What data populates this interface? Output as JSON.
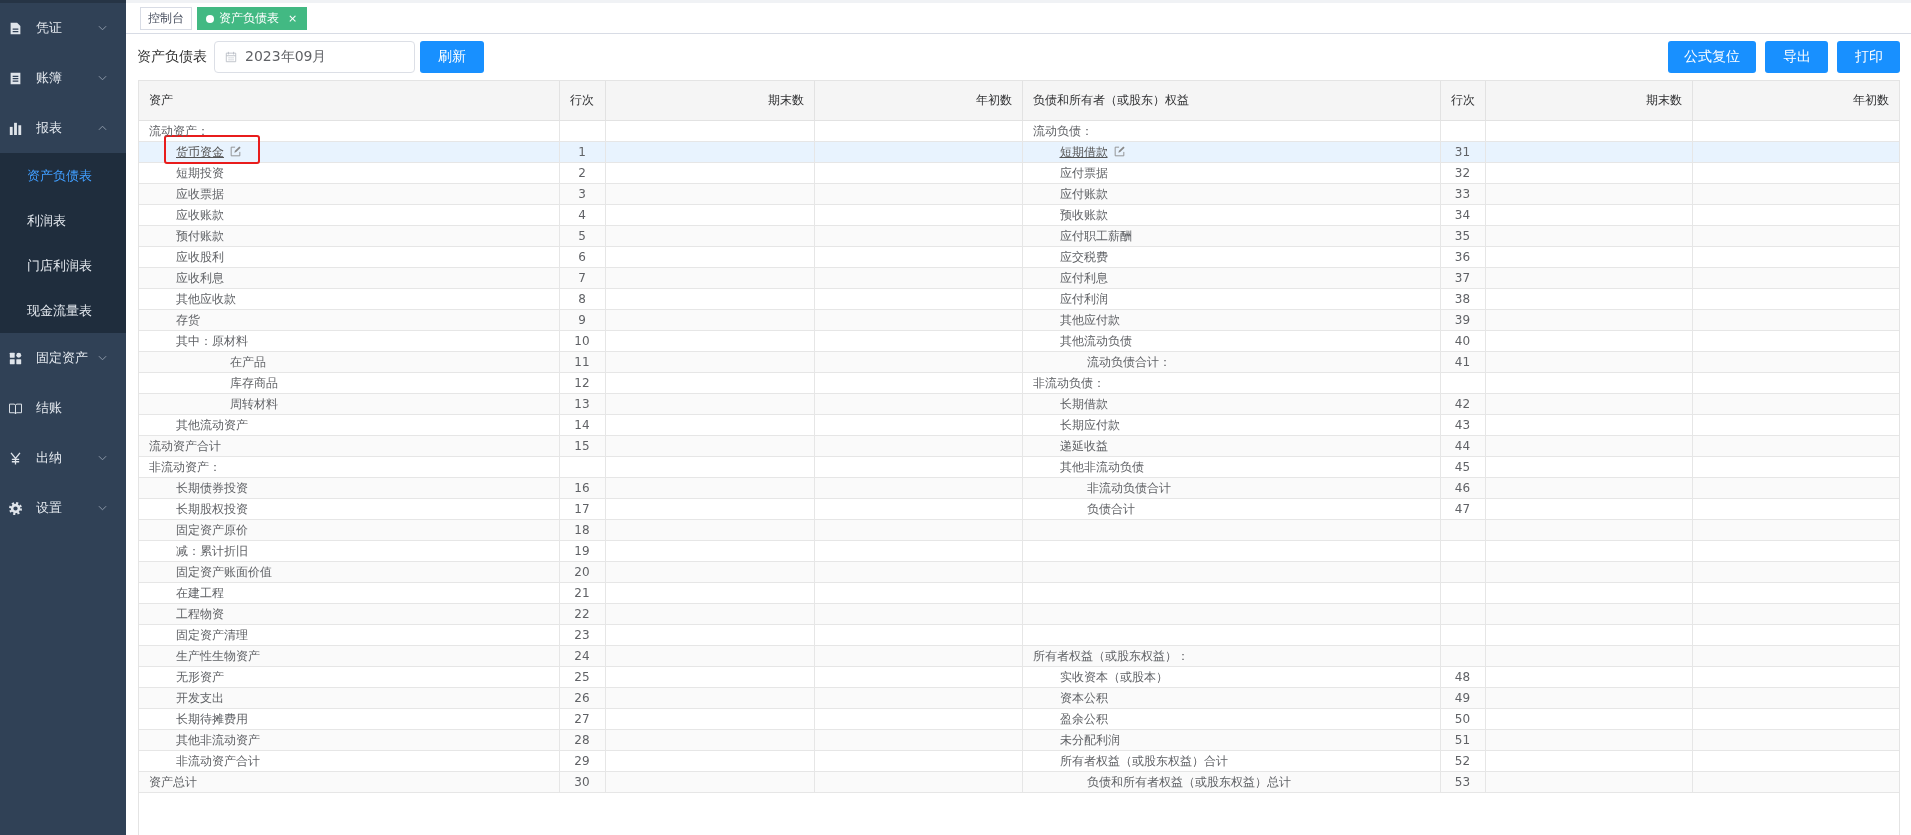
{
  "sidebar": {
    "items": [
      {
        "label": "凭证",
        "kind": "submenu",
        "expanded": false
      },
      {
        "label": "账簿",
        "kind": "submenu",
        "expanded": false
      },
      {
        "label": "报表",
        "kind": "submenu",
        "expanded": true,
        "children": [
          {
            "label": "资产负债表",
            "selected": true
          },
          {
            "label": "利润表",
            "selected": false
          },
          {
            "label": "门店利润表",
            "selected": false
          },
          {
            "label": "现金流量表",
            "selected": false
          }
        ]
      },
      {
        "label": "固定资产",
        "kind": "submenu",
        "expanded": false
      },
      {
        "label": "结账",
        "kind": "item"
      },
      {
        "label": "出纳",
        "kind": "submenu",
        "expanded": false
      },
      {
        "label": "设置",
        "kind": "submenu",
        "expanded": false
      }
    ]
  },
  "tabs": [
    {
      "label": "控制台",
      "selected": false
    },
    {
      "label": "资产负债表",
      "selected": true,
      "close": "×"
    }
  ],
  "toolbar": {
    "title": "资产负债表",
    "date": {
      "value": "2023年09月"
    },
    "refresh_button": "刷新",
    "actions": [
      "公式复位",
      "导出",
      "打印"
    ]
  },
  "table": {
    "columns": [
      "资产",
      "行次",
      "期末数",
      "年初数",
      "负债和所有者（或股东）权益",
      "行次",
      "期末数",
      "年初数"
    ],
    "rows": [
      {
        "selected": false,
        "boxed": false,
        "asset": {
          "name": "流动资产：",
          "kind": "heading"
        },
        "liability": {
          "name": "流动负债：",
          "kind": "heading"
        }
      },
      {
        "selected": true,
        "boxed": true,
        "asset": {
          "name": "货币资金",
          "line": "1",
          "kind": "link"
        },
        "liability": {
          "name": "短期借款",
          "line": "31",
          "kind": "link"
        }
      },
      {
        "selected": false,
        "boxed": false,
        "asset": {
          "name": "短期投资",
          "line": "2",
          "kind": "item"
        },
        "liability": {
          "name": "应付票据",
          "line": "32",
          "kind": "item"
        }
      },
      {
        "selected": false,
        "boxed": false,
        "asset": {
          "name": "应收票据",
          "line": "3",
          "kind": "item"
        },
        "liability": {
          "name": "应付账款",
          "line": "33",
          "kind": "item"
        }
      },
      {
        "selected": false,
        "boxed": false,
        "asset": {
          "name": "应收账款",
          "line": "4",
          "kind": "item"
        },
        "liability": {
          "name": "预收账款",
          "line": "34",
          "kind": "item"
        }
      },
      {
        "selected": false,
        "boxed": false,
        "asset": {
          "name": "预付账款",
          "line": "5",
          "kind": "item"
        },
        "liability": {
          "name": "应付职工薪酬",
          "line": "35",
          "kind": "item"
        }
      },
      {
        "selected": false,
        "boxed": false,
        "asset": {
          "name": "应收股利",
          "line": "6",
          "kind": "item"
        },
        "liability": {
          "name": "应交税费",
          "line": "36",
          "kind": "item"
        }
      },
      {
        "selected": false,
        "boxed": false,
        "asset": {
          "name": "应收利息",
          "line": "7",
          "kind": "item"
        },
        "liability": {
          "name": "应付利息",
          "line": "37",
          "kind": "item"
        }
      },
      {
        "selected": false,
        "boxed": false,
        "asset": {
          "name": "其他应收款",
          "line": "8",
          "kind": "item"
        },
        "liability": {
          "name": "应付利润",
          "line": "38",
          "kind": "item"
        }
      },
      {
        "selected": false,
        "boxed": false,
        "asset": {
          "name": "存货",
          "line": "9",
          "kind": "item"
        },
        "liability": {
          "name": "其他应付款",
          "line": "39",
          "kind": "item"
        }
      },
      {
        "selected": false,
        "boxed": false,
        "asset": {
          "name": "其中：原材料",
          "line": "10",
          "kind": "item"
        },
        "liability": {
          "name": "其他流动负债",
          "line": "40",
          "kind": "item"
        }
      },
      {
        "selected": false,
        "boxed": false,
        "asset": {
          "name": "在产品",
          "line": "11",
          "kind": "subitem"
        },
        "liability": {
          "name": "流动负债合计：",
          "line": "41",
          "kind": "subtotal"
        }
      },
      {
        "selected": false,
        "boxed": false,
        "asset": {
          "name": "库存商品",
          "line": "12",
          "kind": "subitem"
        },
        "liability": {
          "name": "非流动负债：",
          "kind": "heading"
        }
      },
      {
        "selected": false,
        "boxed": false,
        "asset": {
          "name": "周转材料",
          "line": "13",
          "kind": "subitem"
        },
        "liability": {
          "name": "长期借款",
          "line": "42",
          "kind": "item"
        }
      },
      {
        "selected": false,
        "boxed": false,
        "asset": {
          "name": "其他流动资产",
          "line": "14",
          "kind": "item"
        },
        "liability": {
          "name": "长期应付款",
          "line": "43",
          "kind": "item"
        }
      },
      {
        "selected": false,
        "boxed": false,
        "asset": {
          "name": "流动资产合计",
          "line": "15",
          "kind": "heading"
        },
        "liability": {
          "name": "递延收益",
          "line": "44",
          "kind": "item"
        }
      },
      {
        "selected": false,
        "boxed": false,
        "asset": {
          "name": "非流动资产：",
          "kind": "heading"
        },
        "liability": {
          "name": "其他非流动负债",
          "line": "45",
          "kind": "item"
        }
      },
      {
        "selected": false,
        "boxed": false,
        "asset": {
          "name": "长期债券投资",
          "line": "16",
          "kind": "item"
        },
        "liability": {
          "name": "非流动负债合计",
          "line": "46",
          "kind": "subtotal"
        }
      },
      {
        "selected": false,
        "boxed": false,
        "asset": {
          "name": "长期股权投资",
          "line": "17",
          "kind": "item"
        },
        "liability": {
          "name": "负债合计",
          "line": "47",
          "kind": "subtotal"
        }
      },
      {
        "selected": false,
        "boxed": false,
        "asset": {
          "name": "固定资产原价",
          "line": "18",
          "kind": "item"
        }
      },
      {
        "selected": false,
        "boxed": false,
        "asset": {
          "name": "减：累计折旧",
          "line": "19",
          "kind": "item"
        }
      },
      {
        "selected": false,
        "boxed": false,
        "asset": {
          "name": "固定资产账面价值",
          "line": "20",
          "kind": "item"
        }
      },
      {
        "selected": false,
        "boxed": false,
        "asset": {
          "name": "在建工程",
          "line": "21",
          "kind": "item"
        }
      },
      {
        "selected": false,
        "boxed": false,
        "asset": {
          "name": "工程物资",
          "line": "22",
          "kind": "item"
        }
      },
      {
        "selected": false,
        "boxed": false,
        "asset": {
          "name": "固定资产清理",
          "line": "23",
          "kind": "item"
        }
      },
      {
        "selected": false,
        "boxed": false,
        "asset": {
          "name": "生产性生物资产",
          "line": "24",
          "kind": "item"
        },
        "liability": {
          "name": "所有者权益（或股东权益）：",
          "kind": "heading"
        }
      },
      {
        "selected": false,
        "boxed": false,
        "asset": {
          "name": "无形资产",
          "line": "25",
          "kind": "item"
        },
        "liability": {
          "name": "实收资本（或股本）",
          "line": "48",
          "kind": "item"
        }
      },
      {
        "selected": false,
        "boxed": false,
        "asset": {
          "name": "开发支出",
          "line": "26",
          "kind": "item"
        },
        "liability": {
          "name": "资本公积",
          "line": "49",
          "kind": "item"
        }
      },
      {
        "selected": false,
        "boxed": false,
        "asset": {
          "name": "长期待摊费用",
          "line": "27",
          "kind": "item"
        },
        "liability": {
          "name": "盈余公积",
          "line": "50",
          "kind": "item"
        }
      },
      {
        "selected": false,
        "boxed": false,
        "asset": {
          "name": "其他非流动资产",
          "line": "28",
          "kind": "item"
        },
        "liability": {
          "name": "未分配利润",
          "line": "51",
          "kind": "item"
        }
      },
      {
        "selected": false,
        "boxed": false,
        "asset": {
          "name": "非流动资产合计",
          "line": "29",
          "kind": "item"
        },
        "liability": {
          "name": "所有者权益（或股东权益）合计",
          "line": "52",
          "kind": "item"
        }
      },
      {
        "selected": false,
        "boxed": false,
        "asset": {
          "name": "资产总计",
          "line": "30",
          "kind": "heading"
        },
        "liability": {
          "name": "负债和所有者权益（或股东权益）总计",
          "line": "53",
          "kind": "subtotal"
        }
      }
    ]
  }
}
